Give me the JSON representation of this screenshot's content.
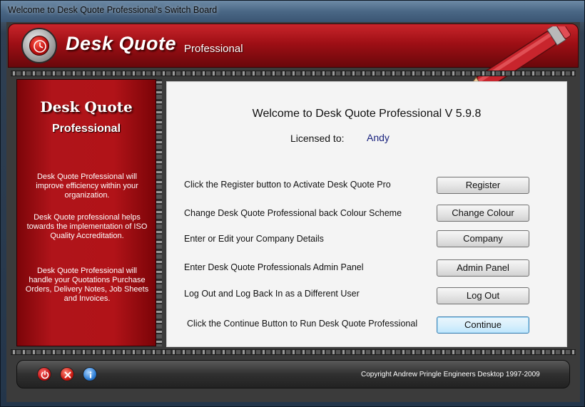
{
  "window": {
    "title": "Welcome to Desk Quote Professional's Switch Board"
  },
  "header": {
    "brand": "Desk Quote",
    "brand_sub": "Professional"
  },
  "sidebar": {
    "title": "Desk Quote",
    "subtitle": "Professional",
    "paragraphs": [
      "Desk Quote Professional will improve efficiency within your organization.",
      "Desk Quote professional helps towards the implementation of ISO Quality Accreditation.",
      "Desk Quote Professional will handle your Quotations Purchase Orders, Delivery Notes, Job Sheets and Invoices."
    ]
  },
  "main": {
    "welcome": "Welcome to Desk Quote Professional V 5.9.8",
    "licensed_label": "Licensed to:",
    "licensed_value": "Andy",
    "rows": [
      {
        "label": "Click the Register button to Activate Desk Quote Pro",
        "button": "Register"
      },
      {
        "label": "Change Desk Quote Professional back Colour Scheme",
        "button": "Change Colour"
      },
      {
        "label": "Enter or Edit your Company Details",
        "button": "Company"
      },
      {
        "label": "Enter Desk Quote Professionals Admin Panel",
        "button": "Admin Panel"
      },
      {
        "label": "Log Out and Log Back In as a Different User",
        "button": "Log Out"
      },
      {
        "label": "Click the Continue Button to Run Desk Quote Professional",
        "button": "Continue"
      }
    ]
  },
  "footer": {
    "copyright": "Copyright Andrew Pringle  Engineers Desktop 1997-2009",
    "icons": [
      "power-icon",
      "close-icon",
      "info-icon"
    ]
  },
  "colors": {
    "accent_red": "#b0141a",
    "link_blue": "#1a237e"
  }
}
